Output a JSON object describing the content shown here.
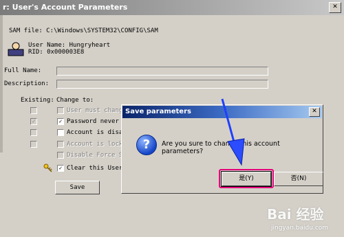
{
  "window": {
    "title": "r: User's Account Parameters",
    "close_glyph": "✕"
  },
  "sam": {
    "file_line": "SAM file: C:\\Windows\\SYSTEM32\\CONFIG\\SAM",
    "user_name_line": "User Name: Hungryheart",
    "rid_line": "RID: 0x000003E8"
  },
  "form": {
    "full_name_label": "Full Name:",
    "description_label": "Description:",
    "existing_label": "Existing:",
    "change_to_label": "Change to:",
    "options": [
      {
        "label": "User must chang",
        "existing": false,
        "change": false,
        "disabled": true
      },
      {
        "label": "Password never",
        "existing": true,
        "change": true,
        "disabled": false
      },
      {
        "label": "Account is disa",
        "existing": false,
        "change": false,
        "disabled": false
      },
      {
        "label": "Account is lock",
        "existing": false,
        "change": false,
        "disabled": true
      },
      {
        "label": "Disable Force S",
        "existing": null,
        "change": false,
        "disabled": true
      },
      {
        "label": "Clear this User",
        "existing": null,
        "change": true,
        "disabled": false
      }
    ],
    "save_label": "Save"
  },
  "dialog": {
    "title": "Save parameters",
    "message": "Are you sure to change this account parameters?",
    "yes_label": "是(Y)",
    "no_label": "否(N)",
    "icon": "question-icon"
  },
  "annotation": {
    "arrow_color": "#1e40ff",
    "highlight_color": "#e6007a"
  },
  "watermark": {
    "brand": "Bai 经验",
    "url": "jingyan.baidu.com"
  }
}
